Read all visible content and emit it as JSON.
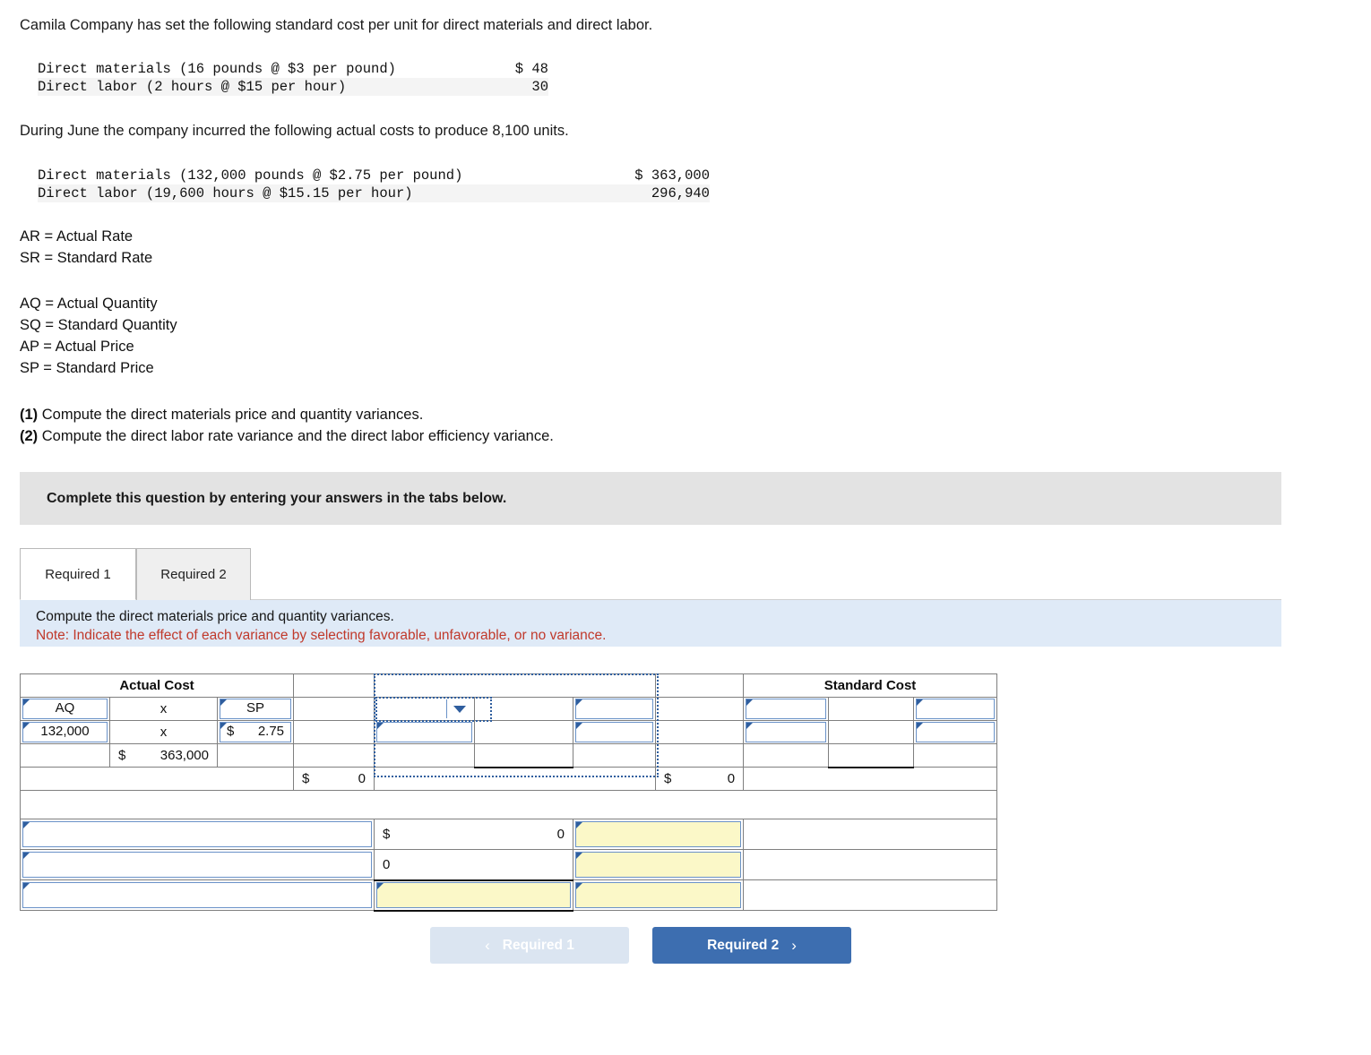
{
  "intro": {
    "line1": "Camila Company has set the following standard cost per unit for direct materials and direct labor.",
    "line2": "During June the company incurred the following actual costs to produce 8,100 units."
  },
  "standard_costs": {
    "rows": [
      {
        "label": "Direct materials (16 pounds @ $3 per pound)",
        "amount": "$ 48"
      },
      {
        "label": "Direct labor (2 hours @ $15 per hour)",
        "amount": "30"
      }
    ]
  },
  "actual_costs": {
    "rows": [
      {
        "label": "Direct materials (132,000 pounds @ $2.75 per pound)",
        "amount": "$ 363,000"
      },
      {
        "label": "Direct labor (19,600 hours @ $15.15 per hour)",
        "amount": "296,940"
      }
    ]
  },
  "definitions": {
    "rate": [
      "AR = Actual Rate",
      "SR = Standard Rate"
    ],
    "quantity": [
      "AQ = Actual Quantity",
      "SQ = Standard Quantity",
      "AP = Actual Price",
      "SP = Standard Price"
    ]
  },
  "tasks": [
    {
      "num": "(1)",
      "text": " Compute the direct materials price and quantity variances."
    },
    {
      "num": "(2)",
      "text": " Compute the direct labor rate variance and the direct labor efficiency variance."
    }
  ],
  "banner": {
    "text": "Complete this question by entering your answers in the tabs below."
  },
  "tabs": [
    {
      "label": "Required 1",
      "active": true
    },
    {
      "label": "Required 2",
      "active": false
    }
  ],
  "note": {
    "line1": "Compute the direct materials price and quantity variances.",
    "line2": "Note: Indicate the effect of each variance by selecting favorable, unfavorable, or no variance."
  },
  "worksheet": {
    "headers": {
      "actual_cost": "Actual Cost",
      "middle": "",
      "standard_cost": "Standard Cost"
    },
    "row_labels": {
      "aq": "AQ",
      "times1": "x",
      "sp": "SP",
      "times2": "x"
    },
    "values": {
      "aq_value": "132,000",
      "sp_currency": "$",
      "sp_value": "2.75",
      "actual_total_currency": "$",
      "actual_total": "363,000",
      "variance1_currency": "$",
      "variance1": "0",
      "variance2_currency": "$",
      "variance2": "0"
    },
    "summary_rows": [
      {
        "label": "",
        "currency": "$",
        "amount": "0",
        "effect": ""
      },
      {
        "label": "",
        "currency": "",
        "amount": "0",
        "effect": ""
      },
      {
        "label": "",
        "currency": "",
        "amount": "",
        "effect": ""
      }
    ],
    "dropdown": {
      "value": ""
    }
  },
  "nav": {
    "prev": {
      "label": "Required 1",
      "chevron": "‹"
    },
    "next": {
      "label": "Required 2",
      "chevron": "›"
    }
  },
  "colors": {
    "header_blue": "#8db0de",
    "input_border": "#6a92c8",
    "yellow_cell": "#fbf8c8",
    "note_bg": "#dfeaf7",
    "note_red": "#c0392b",
    "banner_gray": "#e3e3e3",
    "btn_next": "#3d6eb0",
    "btn_prev": "#dbe5f1"
  }
}
